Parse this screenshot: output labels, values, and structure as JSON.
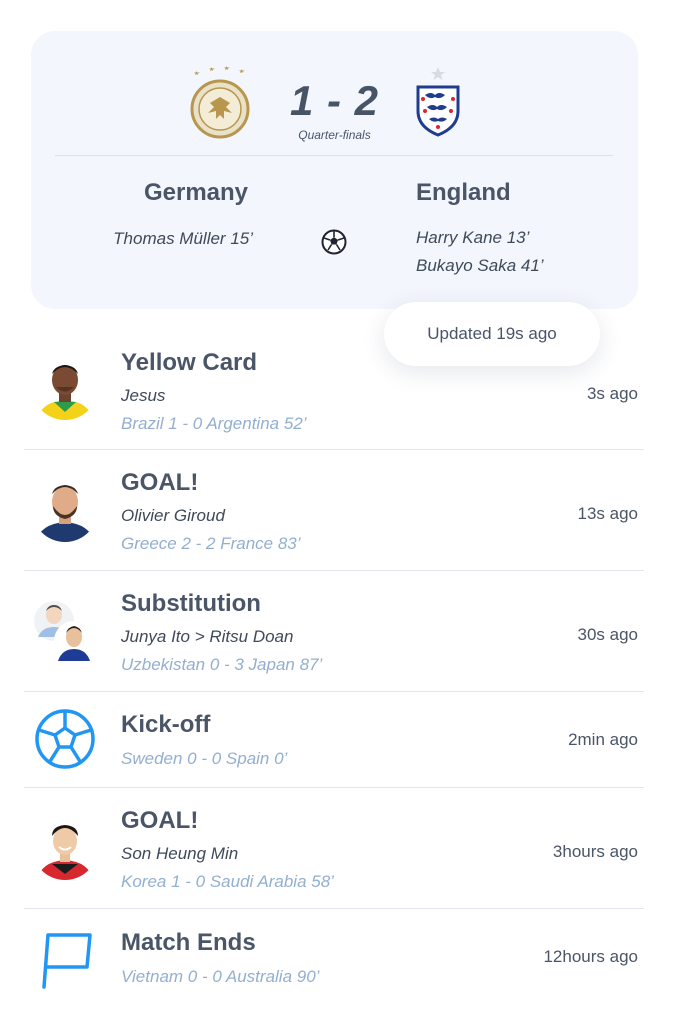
{
  "match": {
    "home_score": "1",
    "separator": "-",
    "away_score": "2",
    "score_text": "1 - 2",
    "stage": "Quarter-finals",
    "home_team": "Germany",
    "away_team": "England",
    "home_scorers": [
      "Thomas Müller 15’"
    ],
    "away_scorers": [
      "Harry Kane 13’",
      "Bukayo Saka 41’"
    ],
    "home_crest_icon": "germany-crest-icon",
    "away_crest_icon": "england-crest-icon",
    "home_stars": 4,
    "away_stars": 1
  },
  "updated": {
    "label": "Updated 19s ago"
  },
  "colors": {
    "card_bg": "#f3f6fc",
    "title": "#4a5568",
    "match_line": "#93afd0",
    "accent_blue": "#2196f3",
    "gold": "#b8964e"
  },
  "events": [
    {
      "title": "Yellow Card",
      "player": "Jesus",
      "match": "Brazil 1 - 0 Argentina 52’",
      "time": "3s ago",
      "icon": "player-avatar-icon"
    },
    {
      "title": "GOAL!",
      "player": "Olivier Giroud",
      "match": "Greece 2 - 2 France 83’",
      "time": "13s ago",
      "icon": "player-avatar-icon"
    },
    {
      "title": "Substitution",
      "player": "Junya Ito > Ritsu Doan",
      "match": "Uzbekistan 0 - 3 Japan 87’",
      "time": "30s ago",
      "icon": "substitution-avatars-icon"
    },
    {
      "title": "Kick-off",
      "player": "",
      "match": "Sweden 0 - 0 Spain 0’",
      "time": "2min ago",
      "icon": "football-icon"
    },
    {
      "title": "GOAL!",
      "player": "Son Heung Min",
      "match": "Korea 1 - 0 Saudi Arabia 58’",
      "time": "3hours ago",
      "icon": "player-avatar-icon"
    },
    {
      "title": "Match Ends",
      "player": "",
      "match": "Vietnam 0 - 0 Australia 90’",
      "time": "12hours ago",
      "icon": "flag-icon"
    }
  ]
}
